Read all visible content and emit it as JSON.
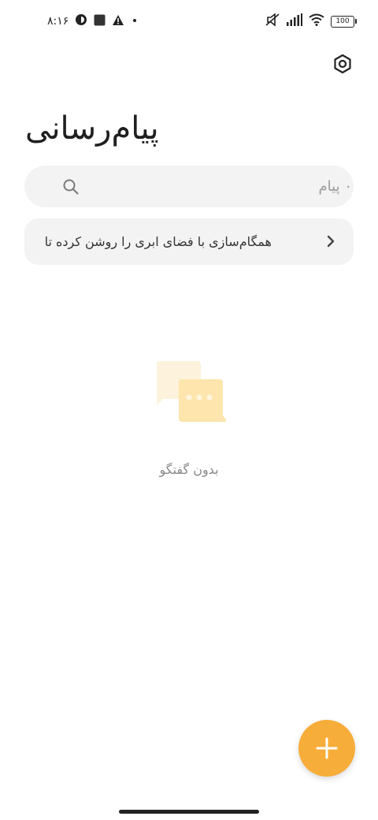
{
  "status_bar": {
    "time": "۸:۱۶",
    "battery_level": "100",
    "icons": [
      "notification-badge-icon",
      "square-app-icon",
      "warning-icon",
      "dot-icon",
      "muted-icon",
      "signal-icon",
      "wifi-icon",
      "battery-icon"
    ]
  },
  "header": {
    "title": "پیام‌رسانی",
    "settings_icon": "settings-icon"
  },
  "search": {
    "placeholder": "۰ پیام",
    "value": ""
  },
  "sync_banner": {
    "text": "همگام‌سازی با فضای ابری را روشن کرده تا",
    "icon": "chevron-right-icon"
  },
  "empty_state": {
    "icon": "chat-bubbles-icon",
    "text": "بدون گفتگو"
  },
  "fab": {
    "icon": "plus-icon",
    "color": "#f7ad3a"
  }
}
